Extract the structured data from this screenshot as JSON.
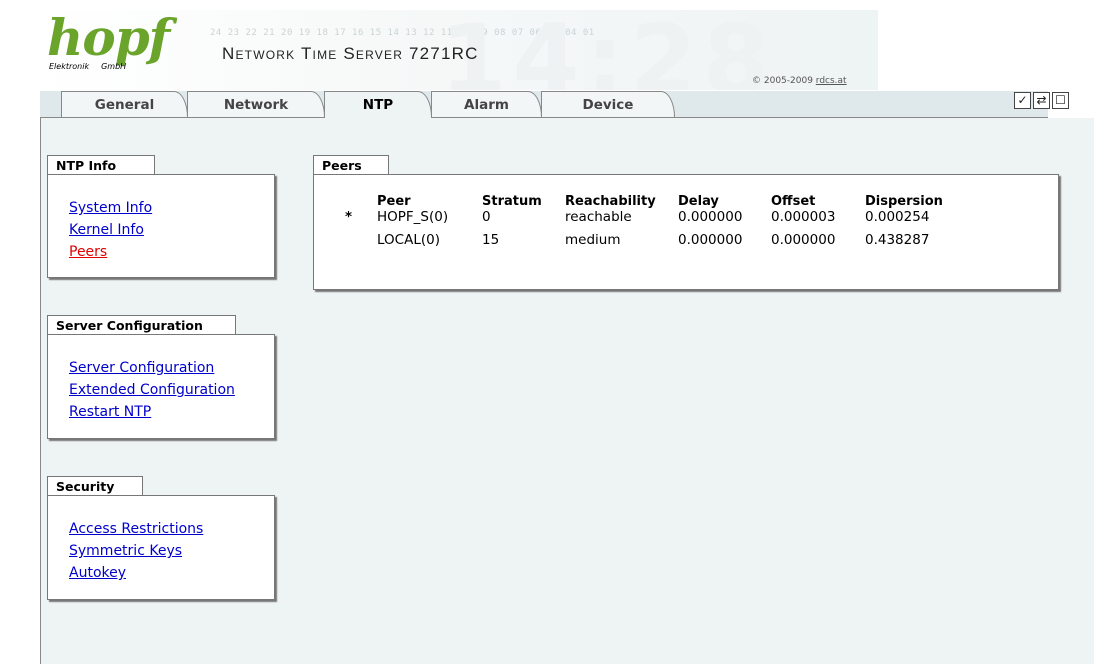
{
  "header": {
    "logo_text": "hopf",
    "logo_sub_left": "Elektronik",
    "logo_sub_right": "GmbH",
    "product": "Network Time Server 7271RC",
    "bg_digits": "24 23 22 21 20 19 18 17 16 15 14 13 12 11 10 09 08 07 06 05 04 01",
    "bg_big": "14:28",
    "copyright_prefix": "© 2005-2009 ",
    "copyright_link": "rdcs.at"
  },
  "tabs": [
    {
      "label": "General"
    },
    {
      "label": "Network"
    },
    {
      "label": "NTP"
    },
    {
      "label": "Alarm"
    },
    {
      "label": "Device"
    }
  ],
  "active_tab": "NTP",
  "controls": {
    "ok": "✓",
    "refresh": "⇄",
    "window": "☐"
  },
  "sidebar": {
    "ntp_info": {
      "title": "NTP Info",
      "links": [
        "System Info",
        "Kernel Info",
        "Peers"
      ]
    },
    "server_config": {
      "title": "Server Configuration",
      "links": [
        "Server Configuration",
        "Extended Configuration",
        "Restart NTP"
      ]
    },
    "security": {
      "title": "Security",
      "links": [
        "Access Restrictions",
        "Symmetric Keys",
        "Autokey"
      ]
    }
  },
  "peers": {
    "title": "Peers",
    "columns": [
      "",
      "Peer",
      "Stratum",
      "Reachability",
      "Delay",
      "Offset",
      "Dispersion"
    ],
    "rows": [
      [
        "*",
        "HOPF_S(0)",
        "0",
        "reachable",
        "0.000000",
        "0.000003",
        "0.000254"
      ],
      [
        "",
        "LOCAL(0)",
        "15",
        "medium",
        "0.000000",
        "0.000000",
        "0.438287"
      ]
    ]
  },
  "colors": {
    "logo_green": "#6aa42a",
    "link_blue": "#0000cc",
    "active_link_red": "#e00000",
    "content_bg": "#eef3f3"
  }
}
